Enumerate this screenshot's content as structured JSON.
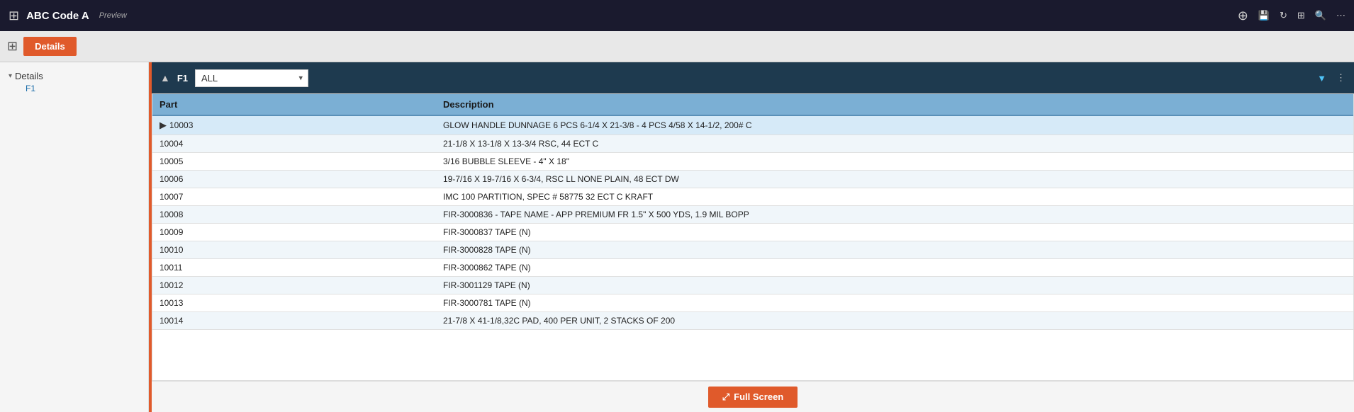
{
  "topbar": {
    "title": "ABC Code A",
    "preview": "Preview",
    "icons": {
      "plus": "+",
      "save": "💾",
      "refresh": "↻",
      "grid": "⊞",
      "search": "🔍",
      "more": "⋯"
    }
  },
  "secondbar": {
    "details_button": "Details"
  },
  "sidebar": {
    "section_label": "Details",
    "child_label": "F1"
  },
  "panel": {
    "label": "F1",
    "dropdown_value": "ALL",
    "dropdown_options": [
      "ALL"
    ],
    "filter_icon": "▼",
    "more_icon": "⋮"
  },
  "table": {
    "columns": [
      {
        "key": "part",
        "label": "Part"
      },
      {
        "key": "description",
        "label": "Description"
      }
    ],
    "rows": [
      {
        "part": "10003",
        "description": "GLOW HANDLE DUNNAGE 6 PCS 6-1/4 X 21-3/8 - 4 PCS 4/58 X 14-1/2, 200# C",
        "selected": true
      },
      {
        "part": "10004",
        "description": "21-1/8 X 13-1/8 X 13-3/4 RSC, 44 ECT C",
        "selected": false
      },
      {
        "part": "10005",
        "description": "3/16 BUBBLE SLEEVE - 4\" X 18\"",
        "selected": false
      },
      {
        "part": "10006",
        "description": "19-7/16 X 19-7/16 X 6-3/4, RSC LL NONE PLAIN, 48 ECT DW",
        "selected": false
      },
      {
        "part": "10007",
        "description": "IMC 100 PARTITION, SPEC # 58775 32 ECT C KRAFT",
        "selected": false
      },
      {
        "part": "10008",
        "description": "FIR-3000836 - TAPE NAME - APP PREMIUM FR 1.5\" X 500 YDS, 1.9 MIL BOPP",
        "selected": false
      },
      {
        "part": "10009",
        "description": "FIR-3000837 TAPE (N)",
        "selected": false
      },
      {
        "part": "10010",
        "description": "FIR-3000828 TAPE (N)",
        "selected": false
      },
      {
        "part": "10011",
        "description": "FIR-3000862 TAPE (N)",
        "selected": false
      },
      {
        "part": "10012",
        "description": "FIR-3001129 TAPE (N)",
        "selected": false
      },
      {
        "part": "10013",
        "description": "FIR-3000781 TAPE (N)",
        "selected": false
      },
      {
        "part": "10014",
        "description": "21-7/8 X 41-1/8,32C PAD, 400 PER UNIT, 2 STACKS OF 200",
        "selected": false
      }
    ]
  },
  "fullscreen": {
    "button_label": "Full Screen",
    "icon": "⤢"
  }
}
